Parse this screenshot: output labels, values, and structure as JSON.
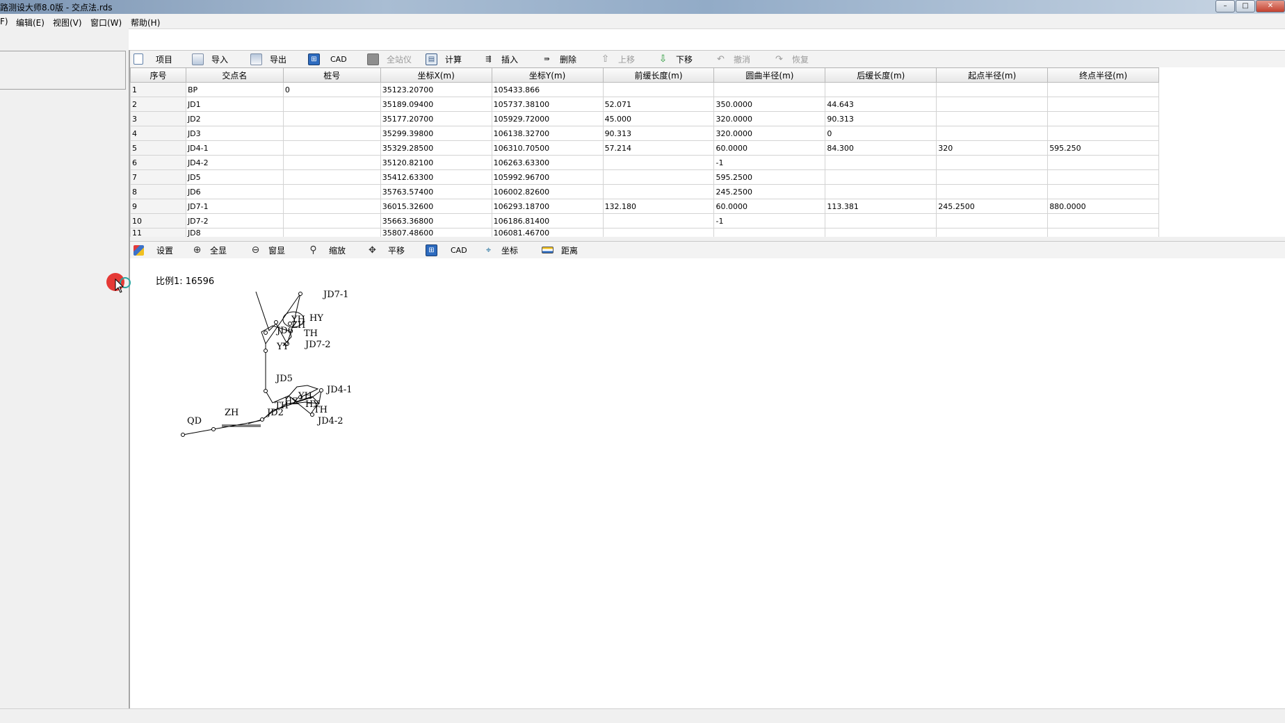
{
  "window": {
    "title": "路测设大师8.0版 - 交点法.rds",
    "buttons": [
      "minimize",
      "maximize",
      "close"
    ]
  },
  "menu": {
    "items": [
      {
        "label": "F)"
      },
      {
        "label": "编辑(E)"
      },
      {
        "label": "视图(V)"
      },
      {
        "label": "窗口(W)"
      },
      {
        "label": "帮助(H)"
      }
    ]
  },
  "table_toolbar": {
    "items": [
      {
        "label": "项目",
        "icon": "new-document-icon",
        "enabled": true
      },
      {
        "label": "导入",
        "icon": "import-icon",
        "enabled": true
      },
      {
        "label": "导出",
        "icon": "export-icon",
        "enabled": true
      },
      {
        "label": "CAD",
        "icon": "cad-icon",
        "enabled": true
      },
      {
        "label": "全站仪",
        "icon": "total-station-icon",
        "enabled": false
      },
      {
        "label": "计算",
        "icon": "calculator-icon",
        "enabled": true
      },
      {
        "label": "插入",
        "icon": "insert-row-icon",
        "enabled": true
      },
      {
        "label": "删除",
        "icon": "delete-row-icon",
        "enabled": true
      },
      {
        "label": "上移",
        "icon": "arrow-up-icon",
        "enabled": false
      },
      {
        "label": "下移",
        "icon": "arrow-down-icon",
        "enabled": true
      },
      {
        "label": "撤消",
        "icon": "undo-icon",
        "enabled": false
      },
      {
        "label": "恢复",
        "icon": "redo-icon",
        "enabled": false
      }
    ]
  },
  "table": {
    "columns": [
      "序号",
      "交点名",
      "桩号",
      "坐标X(m)",
      "坐标Y(m)",
      "前缓长度(m)",
      "圆曲半径(m)",
      "后缓长度(m)",
      "起点半径(m)",
      "终点半径(m)"
    ],
    "rows": [
      [
        "1",
        "BP",
        "0",
        "35123.20700",
        "105433.866",
        "",
        "",
        "",
        "",
        ""
      ],
      [
        "2",
        "JD1",
        "",
        "35189.09400",
        "105737.38100",
        "52.071",
        "350.0000",
        "44.643",
        "",
        ""
      ],
      [
        "3",
        "JD2",
        "",
        "35177.20700",
        "105929.72000",
        "45.000",
        "320.0000",
        "90.313",
        "",
        ""
      ],
      [
        "4",
        "JD3",
        "",
        "35299.39800",
        "106138.32700",
        "90.313",
        "320.0000",
        "0",
        "",
        ""
      ],
      [
        "5",
        "JD4-1",
        "",
        "35329.28500",
        "106310.70500",
        "57.214",
        "60.0000",
        "84.300",
        "320",
        "595.250"
      ],
      [
        "6",
        "JD4-2",
        "",
        "35120.82100",
        "106263.63300",
        "",
        "-1",
        "",
        "",
        ""
      ],
      [
        "7",
        "JD5",
        "",
        "35412.63300",
        "105992.96700",
        "",
        "595.2500",
        "",
        "",
        ""
      ],
      [
        "8",
        "JD6",
        "",
        "35763.57400",
        "106002.82600",
        "",
        "245.2500",
        "",
        "",
        ""
      ],
      [
        "9",
        "JD7-1",
        "",
        "36015.32600",
        "106293.18700",
        "132.180",
        "60.0000",
        "113.381",
        "245.2500",
        "880.0000"
      ],
      [
        "10",
        "JD7-2",
        "",
        "35663.36800",
        "106186.81400",
        "",
        "-1",
        "",
        "",
        ""
      ],
      [
        "11",
        "JD8",
        "",
        "35807.48600",
        "106081.46700",
        "",
        "",
        "",
        "",
        ""
      ]
    ]
  },
  "graphic_toolbar": {
    "items": [
      {
        "label": "设置",
        "icon": "settings-palette-icon"
      },
      {
        "label": "全显",
        "icon": "zoom-extents-icon"
      },
      {
        "label": "窗显",
        "icon": "zoom-window-icon"
      },
      {
        "label": "缩放",
        "icon": "zoom-icon"
      },
      {
        "label": "平移",
        "icon": "pan-icon"
      },
      {
        "label": "CAD",
        "icon": "cad-icon"
      },
      {
        "label": "坐标",
        "icon": "coordinate-icon"
      },
      {
        "label": "距离",
        "icon": "distance-icon"
      }
    ]
  },
  "plot": {
    "scale_label": "比例1: 16596",
    "labels": {
      "jd7_1": "JD7-1",
      "hy_top": "HY",
      "yh_top": "YH",
      "zh_top": "ZH",
      "jd6": "JD6",
      "th_top": "TH",
      "jd7_2": "JD7-2",
      "yy": "YY",
      "jd5": "JD5",
      "jd4_1": "JD4-1",
      "hy_bottom": "HY",
      "yh_bottom": "YH",
      "hz_bottom": "HZ",
      "th_bottom": "TH",
      "jd4_2": "JD4-2",
      "zh_bottom": "ZH",
      "jd2": "JD2",
      "th_left": "TH",
      "qd": "QD"
    }
  }
}
